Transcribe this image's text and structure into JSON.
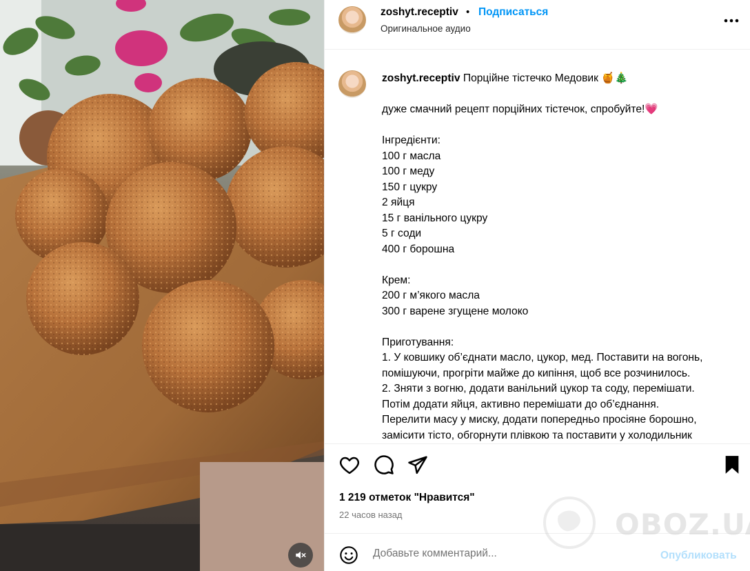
{
  "header": {
    "username": "zoshyt.receptiv",
    "dot": "•",
    "follow_label": "Подписаться",
    "audio_label": "Оригинальное аудио",
    "more_icon": "more-horizontal-icon"
  },
  "caption": {
    "username": "zoshyt.receptiv",
    "title": "Порційне тістечко Медовик 🍯🎄",
    "paragraphs": [
      [
        "дуже смачний рецепт порційних тістечок, спробуйте!💗"
      ],
      [
        "Інгредієнти:",
        "100 г масла",
        "100 г меду",
        "150 г цукру",
        "2 яйця",
        "15 г ванільного цукру",
        "5 г соди",
        "400 г борошна"
      ],
      [
        "Крем:",
        "200 г м’якого масла",
        "300 г варене згущене молоко"
      ],
      [
        "Приготування:",
        "1. У ковшику об’єднати масло, цукор, мед. Поставити на вогонь,",
        "помішуючи, прогріти майже до кипіння, щоб все розчинилось.",
        "2. Зняти з вогню, додати ванільний цукор та соду, перемішати.",
        "Потім додати яйця, активно перемішати до об’єднання.",
        "Перелити масу у миску, додати попередньо просіяне борошно,",
        "замісити тісто, обгорнути плівкою та поставити у холодильник"
      ]
    ]
  },
  "actions": {
    "like_icon": "heart-icon",
    "comment_icon": "comment-icon",
    "share_icon": "share-icon",
    "save_icon": "bookmark-icon",
    "likes_text": "1 219 отметок \"Нравится\"",
    "time_text": "22 часов назад"
  },
  "comment": {
    "placeholder": "Добавьте комментарий...",
    "publish_label": "Опубликовать",
    "emoji_icon": "emoji-icon"
  },
  "media": {
    "mute_icon": "volume-muted-icon"
  },
  "watermark": {
    "text": "OBOZ.UA"
  }
}
